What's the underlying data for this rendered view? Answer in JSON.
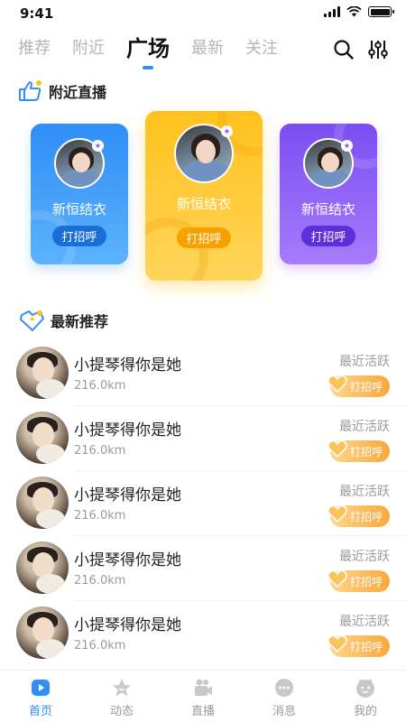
{
  "status_bar": {
    "time": "9:41"
  },
  "top_tabs": [
    {
      "label": "推荐",
      "active": false
    },
    {
      "label": "附近",
      "active": false
    },
    {
      "label": "广场",
      "active": true
    },
    {
      "label": "最新",
      "active": false
    },
    {
      "label": "关注",
      "active": false
    }
  ],
  "top_actions": {
    "search_icon": "search-icon",
    "filter_icon": "filter-icon"
  },
  "nearby_section": {
    "title": "附近直播",
    "cards": [
      {
        "name": "新恒结衣",
        "button": "打招呼",
        "color": "#2f8ef8"
      },
      {
        "name": "新恒结衣",
        "button": "打招呼",
        "color": "#ffc21c"
      },
      {
        "name": "新恒结衣",
        "button": "打招呼",
        "color": "#8a55f5"
      }
    ]
  },
  "recommend_section": {
    "title": "最新推荐",
    "items": [
      {
        "name": "小提琴得你是她",
        "distance": "216.0km",
        "status": "最近活跃",
        "button": "打招呼"
      },
      {
        "name": "小提琴得你是她",
        "distance": "216.0km",
        "status": "最近活跃",
        "button": "打招呼"
      },
      {
        "name": "小提琴得你是她",
        "distance": "216.0km",
        "status": "最近活跃",
        "button": "打招呼"
      },
      {
        "name": "小提琴得你是她",
        "distance": "216.0km",
        "status": "最近活跃",
        "button": "打招呼"
      },
      {
        "name": "小提琴得你是她",
        "distance": "216.0km",
        "status": "最近活跃",
        "button": "打招呼"
      }
    ]
  },
  "bottom_nav": [
    {
      "label": "首页",
      "icon": "home-play-icon",
      "active": true
    },
    {
      "label": "动态",
      "icon": "star-icon",
      "active": false
    },
    {
      "label": "直播",
      "icon": "camera-icon",
      "active": false
    },
    {
      "label": "消息",
      "icon": "chat-icon",
      "active": false
    },
    {
      "label": "我的",
      "icon": "profile-face-icon",
      "active": false
    }
  ],
  "colors": {
    "accent": "#2f8ef8",
    "greet_orange": "#f7a93b",
    "inactive_text": "#b5b5b5"
  }
}
